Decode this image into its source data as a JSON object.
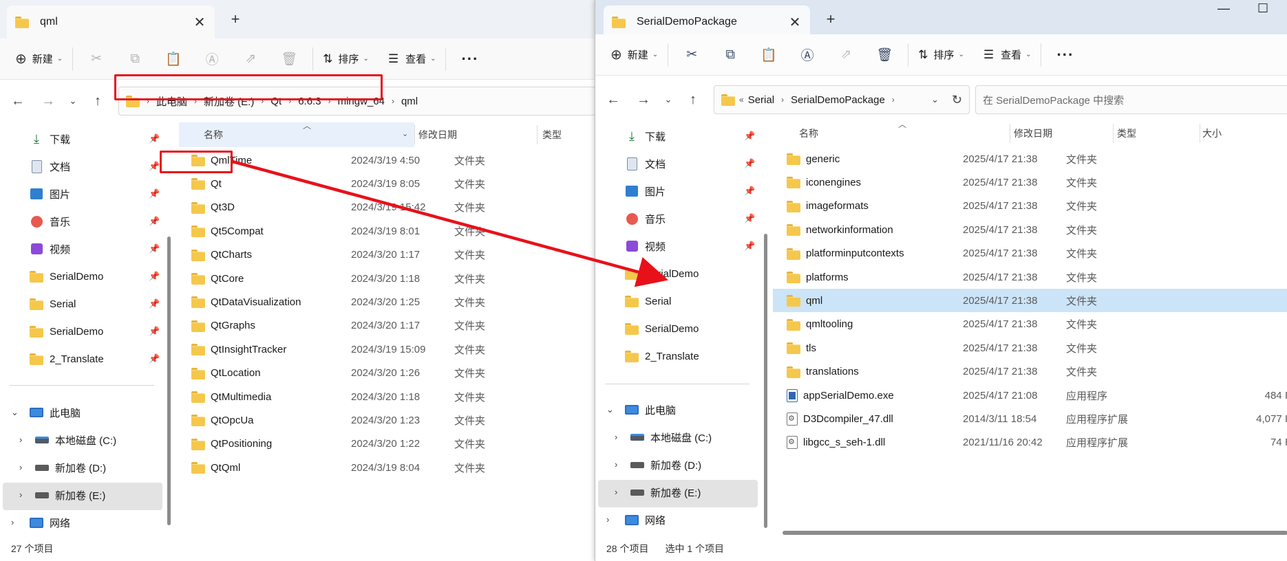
{
  "left": {
    "tab_title": "qml",
    "new_tab": "+",
    "toolbar": {
      "new_label": "新建",
      "sort_label": "排序",
      "view_label": "查看",
      "more_label": "···"
    },
    "breadcrumbs": [
      "此电脑",
      "新加卷 (E:)",
      "Qt",
      "6.6.3",
      "mingw_64",
      "qml"
    ],
    "nav_items": [
      {
        "label": "下载",
        "icon": "download-icon"
      },
      {
        "label": "文档",
        "icon": "document-icon"
      },
      {
        "label": "图片",
        "icon": "picture-icon"
      },
      {
        "label": "音乐",
        "icon": "music-icon"
      },
      {
        "label": "视频",
        "icon": "video-icon"
      },
      {
        "label": "SerialDemo",
        "icon": "folder-icon"
      },
      {
        "label": "Serial",
        "icon": "folder-icon"
      },
      {
        "label": "SerialDemo",
        "icon": "folder-icon"
      },
      {
        "label": "2_Translate",
        "icon": "folder-icon"
      }
    ],
    "tree": [
      {
        "label": "此电脑",
        "icon": "pc-icon"
      },
      {
        "label": "本地磁盘 (C:)",
        "icon": "drive-icon"
      },
      {
        "label": "新加卷 (D:)",
        "icon": "drive-icon"
      },
      {
        "label": "新加卷 (E:)",
        "icon": "drive-icon"
      },
      {
        "label": "网络",
        "icon": "network-icon"
      }
    ],
    "columns": {
      "name": "名称",
      "date": "修改日期",
      "type": "类型"
    },
    "rows": [
      {
        "name": "QmlTime",
        "date": "2024/3/19 4:50",
        "type": "文件夹"
      },
      {
        "name": "Qt",
        "date": "2024/3/19 8:05",
        "type": "文件夹"
      },
      {
        "name": "Qt3D",
        "date": "2024/3/19 15:42",
        "type": "文件夹"
      },
      {
        "name": "Qt5Compat",
        "date": "2024/3/19 8:01",
        "type": "文件夹"
      },
      {
        "name": "QtCharts",
        "date": "2024/3/20 1:17",
        "type": "文件夹"
      },
      {
        "name": "QtCore",
        "date": "2024/3/20 1:18",
        "type": "文件夹"
      },
      {
        "name": "QtDataVisualization",
        "date": "2024/3/20 1:25",
        "type": "文件夹"
      },
      {
        "name": "QtGraphs",
        "date": "2024/3/20 1:17",
        "type": "文件夹"
      },
      {
        "name": "QtInsightTracker",
        "date": "2024/3/19 15:09",
        "type": "文件夹"
      },
      {
        "name": "QtLocation",
        "date": "2024/3/20 1:26",
        "type": "文件夹"
      },
      {
        "name": "QtMultimedia",
        "date": "2024/3/20 1:18",
        "type": "文件夹"
      },
      {
        "name": "QtOpcUa",
        "date": "2024/3/20 1:23",
        "type": "文件夹"
      },
      {
        "name": "QtPositioning",
        "date": "2024/3/20 1:22",
        "type": "文件夹"
      },
      {
        "name": "QtQml",
        "date": "2024/3/19 8:04",
        "type": "文件夹"
      }
    ],
    "status": "27 个项目"
  },
  "right": {
    "tab_title": "SerialDemoPackage",
    "new_tab": "+",
    "window_controls": {
      "minimize": "—",
      "maximize": "☐"
    },
    "toolbar": {
      "new_label": "新建",
      "sort_label": "排序",
      "view_label": "查看",
      "more_label": "···"
    },
    "breadcrumb_overflow": "«",
    "breadcrumbs": [
      "Serial",
      "SerialDemoPackage"
    ],
    "search_placeholder": "在 SerialDemoPackage 中搜索",
    "nav_items": [
      {
        "label": "下载",
        "icon": "download-icon"
      },
      {
        "label": "文档",
        "icon": "document-icon"
      },
      {
        "label": "图片",
        "icon": "picture-icon"
      },
      {
        "label": "音乐",
        "icon": "music-icon"
      },
      {
        "label": "视频",
        "icon": "video-icon"
      },
      {
        "label": "SerialDemo",
        "icon": "folder-icon"
      },
      {
        "label": "Serial",
        "icon": "folder-icon"
      },
      {
        "label": "SerialDemo",
        "icon": "folder-icon"
      },
      {
        "label": "2_Translate",
        "icon": "folder-icon"
      }
    ],
    "tree": [
      {
        "label": "此电脑",
        "icon": "pc-icon"
      },
      {
        "label": "本地磁盘 (C:)",
        "icon": "drive-icon"
      },
      {
        "label": "新加卷 (D:)",
        "icon": "drive-icon"
      },
      {
        "label": "新加卷 (E:)",
        "icon": "drive-icon"
      },
      {
        "label": "网络",
        "icon": "network-icon"
      }
    ],
    "columns": {
      "name": "名称",
      "date": "修改日期",
      "type": "类型",
      "size": "大小"
    },
    "rows": [
      {
        "name": "generic",
        "date": "2025/4/17 21:38",
        "type": "文件夹",
        "size": "",
        "icon": "folder"
      },
      {
        "name": "iconengines",
        "date": "2025/4/17 21:38",
        "type": "文件夹",
        "size": "",
        "icon": "folder"
      },
      {
        "name": "imageformats",
        "date": "2025/4/17 21:38",
        "type": "文件夹",
        "size": "",
        "icon": "folder"
      },
      {
        "name": "networkinformation",
        "date": "2025/4/17 21:38",
        "type": "文件夹",
        "size": "",
        "icon": "folder"
      },
      {
        "name": "platforminputcontexts",
        "date": "2025/4/17 21:38",
        "type": "文件夹",
        "size": "",
        "icon": "folder"
      },
      {
        "name": "platforms",
        "date": "2025/4/17 21:38",
        "type": "文件夹",
        "size": "",
        "icon": "folder"
      },
      {
        "name": "qml",
        "date": "2025/4/17 21:38",
        "type": "文件夹",
        "size": "",
        "icon": "folder",
        "selected": true
      },
      {
        "name": "qmltooling",
        "date": "2025/4/17 21:38",
        "type": "文件夹",
        "size": "",
        "icon": "folder"
      },
      {
        "name": "tls",
        "date": "2025/4/17 21:38",
        "type": "文件夹",
        "size": "",
        "icon": "folder"
      },
      {
        "name": "translations",
        "date": "2025/4/17 21:38",
        "type": "文件夹",
        "size": "",
        "icon": "folder"
      },
      {
        "name": "appSerialDemo.exe",
        "date": "2025/4/17 21:08",
        "type": "应用程序",
        "size": "484 I",
        "icon": "exe"
      },
      {
        "name": "D3Dcompiler_47.dll",
        "date": "2014/3/11 18:54",
        "type": "应用程序扩展",
        "size": "4,077 I",
        "icon": "dll"
      },
      {
        "name": "libgcc_s_seh-1.dll",
        "date": "2021/11/16 20:42",
        "type": "应用程序扩展",
        "size": "74 I",
        "icon": "dll"
      }
    ],
    "status": "28 个项目",
    "status_selected": "选中 1 个项目"
  },
  "colors": {
    "annotation_red": "#e8111a",
    "selection_blue": "#cce4f7",
    "folder_yellow": "#f5c84c"
  }
}
